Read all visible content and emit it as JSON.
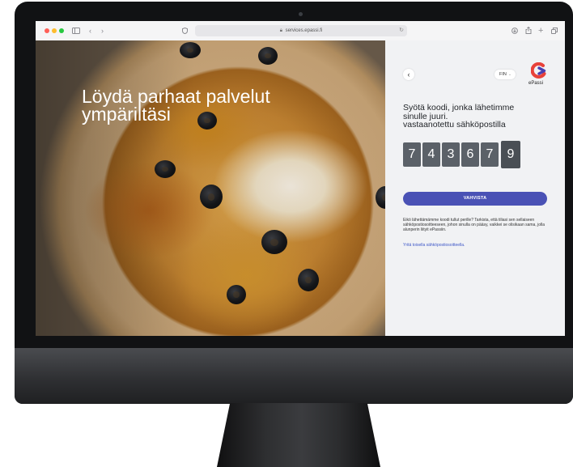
{
  "browser": {
    "url": "services.epassi.fi"
  },
  "hero": {
    "headline_line1": "Löydä parhaat palvelut",
    "headline_line2": "ympäriltäsi"
  },
  "panel": {
    "back_glyph": "‹",
    "language": "FIN",
    "logo_text": "ePassi",
    "title_line1": "Syötä koodi, jonka lähetimme",
    "title_line2": "sinulle juuri.",
    "title_line3": "vastaanotettu sähköpostilla",
    "code_digits": [
      "7",
      "4",
      "3",
      "6",
      "7",
      "9"
    ],
    "confirm_label": "VAHVISTA",
    "help_text": "Eikö lähettämämme koodi tullut perille? Tarkista, että tiliasi sen sellaiseen sähköpostiosoitteeseen, johon sinulla on pääsy, vaikkei se olisikaan sama, jolla alunperin liityit ePassiin.",
    "help_link": "Yritä toisella sähköpostiosoitteella."
  },
  "colors": {
    "accent": "#4a52b5",
    "digit_box": "#5b6168",
    "panel_bg": "#f1f2f4",
    "logo_red": "#e8423a",
    "logo_purple": "#4a3fb0"
  },
  "icons": [
    "sidebar-icon",
    "chevron-left-icon",
    "chevron-right-icon",
    "privacy-shield-icon",
    "lock-icon",
    "reload-icon",
    "download-icon",
    "share-icon",
    "new-tab-icon",
    "tabs-icon",
    "epassi-logo-icon"
  ]
}
